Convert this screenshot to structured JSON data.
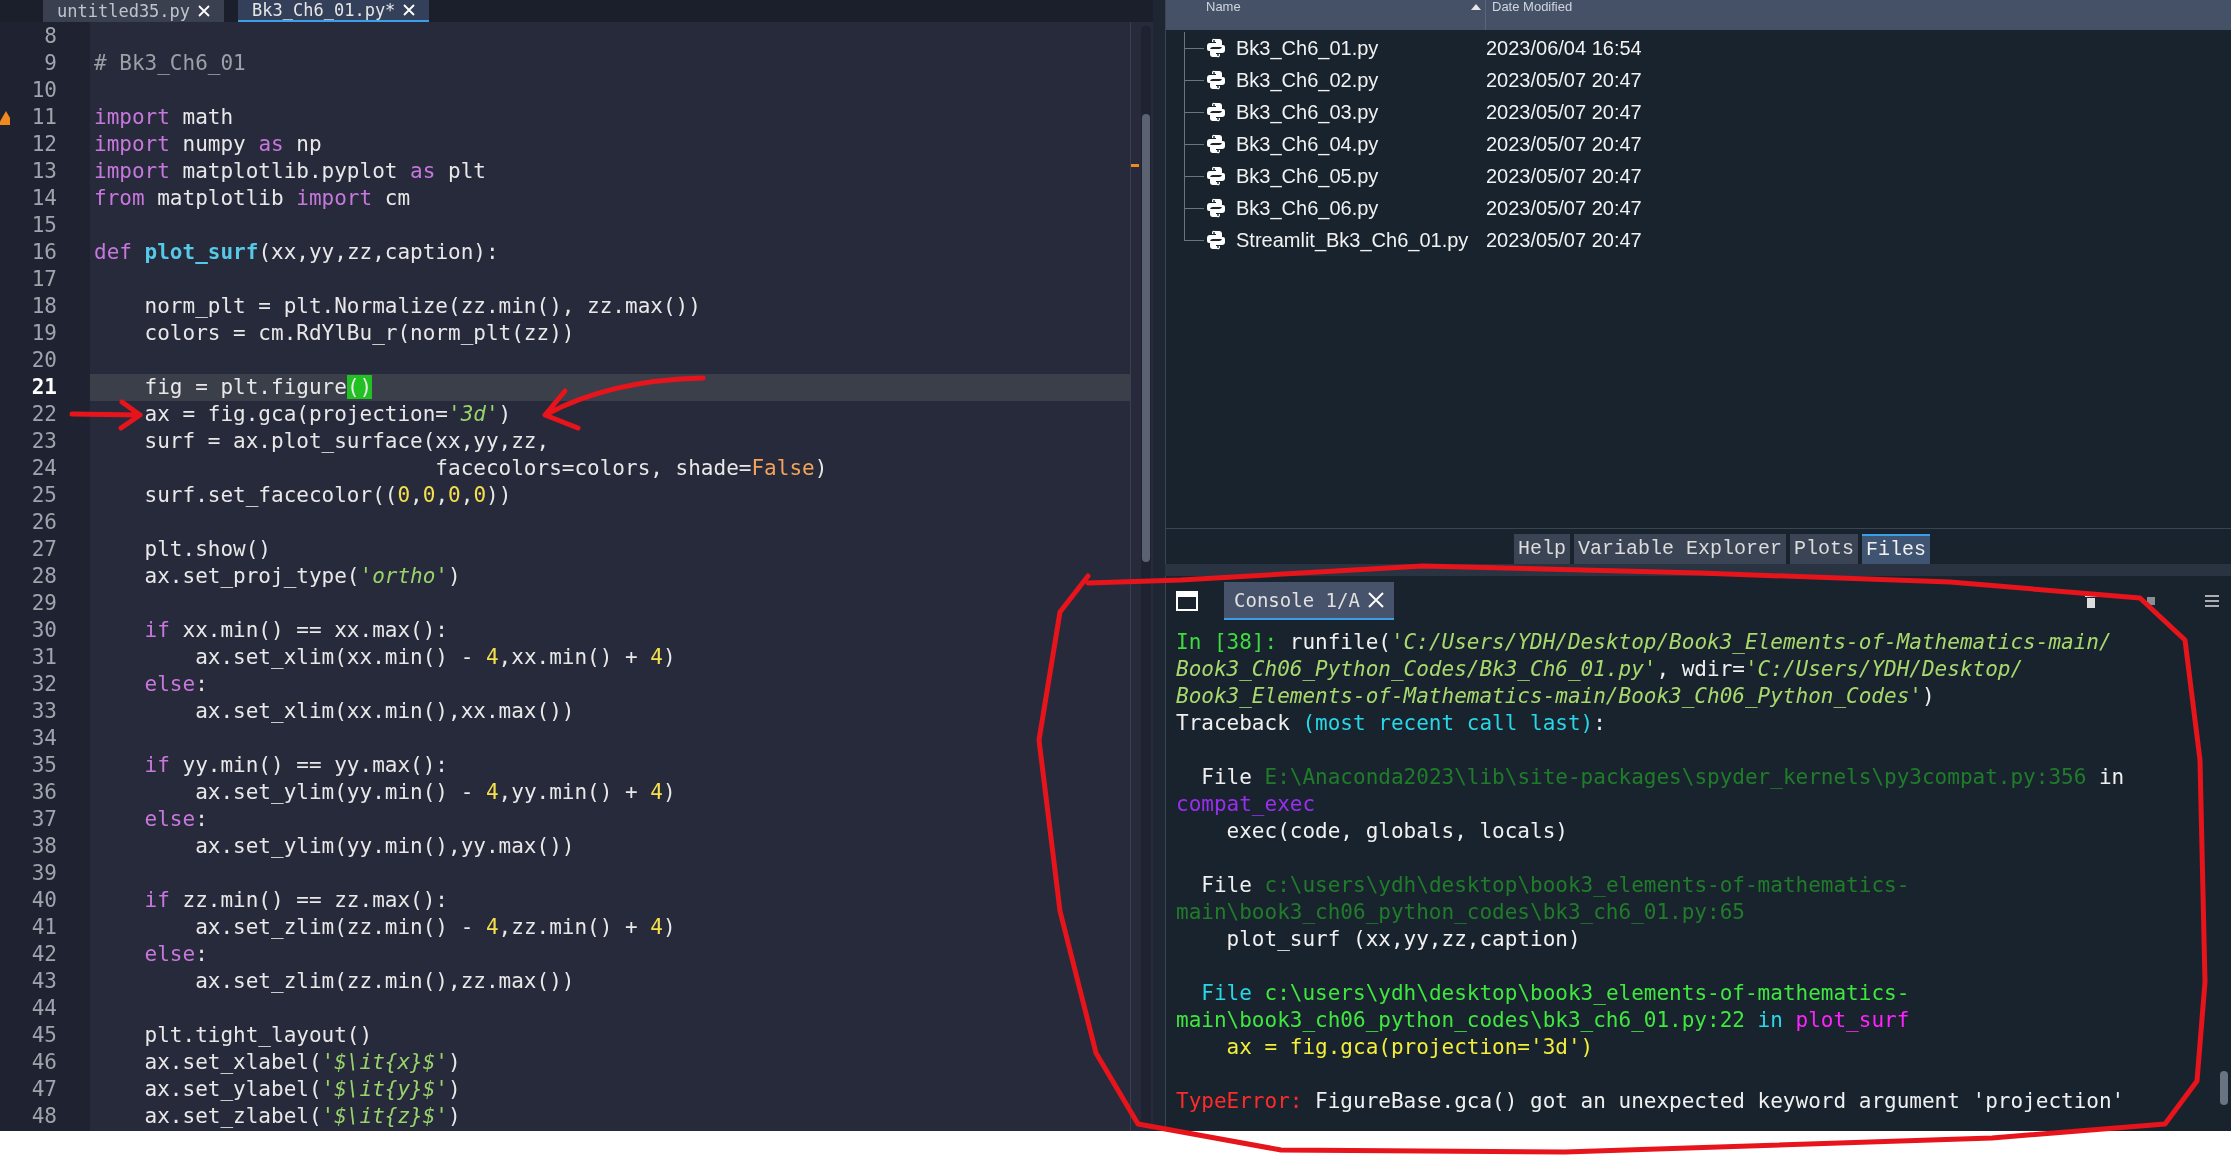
{
  "editor": {
    "tabs": [
      {
        "label": "untitled35.py",
        "selected": false
      },
      {
        "label": "Bk3_Ch6_01.py*",
        "selected": true
      }
    ],
    "lines": [
      {
        "number": "8",
        "current": false,
        "warning": false
      },
      {
        "number": "9",
        "current": false,
        "warning": false,
        "segments": [
          {
            "kind": "comment",
            "text": "# Bk3_Ch6_01"
          }
        ]
      },
      {
        "number": "10",
        "current": false,
        "warning": false
      },
      {
        "number": "11",
        "current": false,
        "warning": true,
        "segments": [
          {
            "kind": "keyword",
            "text": "import"
          },
          {
            "kind": "plain",
            "text": " math"
          }
        ]
      },
      {
        "number": "12",
        "current": false,
        "warning": false,
        "segments": [
          {
            "kind": "keyword",
            "text": "import"
          },
          {
            "kind": "plain",
            "text": " numpy "
          },
          {
            "kind": "keyword",
            "text": "as"
          },
          {
            "kind": "plain",
            "text": " np"
          }
        ]
      },
      {
        "number": "13",
        "current": false,
        "warning": false,
        "segments": [
          {
            "kind": "keyword",
            "text": "import"
          },
          {
            "kind": "plain",
            "text": " matplotlib.pyplot "
          },
          {
            "kind": "keyword",
            "text": "as"
          },
          {
            "kind": "plain",
            "text": " plt"
          }
        ]
      },
      {
        "number": "14",
        "current": false,
        "warning": false,
        "segments": [
          {
            "kind": "keyword",
            "text": "from"
          },
          {
            "kind": "plain",
            "text": " matplotlib "
          },
          {
            "kind": "keyword",
            "text": "import"
          },
          {
            "kind": "plain",
            "text": " cm"
          }
        ]
      },
      {
        "number": "15",
        "current": false,
        "warning": false
      },
      {
        "number": "16",
        "current": false,
        "warning": false,
        "segments": [
          {
            "kind": "keyword",
            "text": "def "
          },
          {
            "kind": "definition",
            "text": "plot_surf"
          },
          {
            "kind": "plain",
            "text": "(xx,yy,zz,caption):"
          }
        ]
      },
      {
        "number": "17",
        "current": false,
        "warning": false
      },
      {
        "number": "18",
        "current": false,
        "warning": false,
        "segments": [
          {
            "kind": "plain",
            "text": "    norm_plt = plt.Normalize(zz.min(), zz.max())"
          }
        ]
      },
      {
        "number": "19",
        "current": false,
        "warning": false,
        "segments": [
          {
            "kind": "plain",
            "text": "    colors = cm.RdYlBu_r(norm_plt(zz))"
          }
        ]
      },
      {
        "number": "20",
        "current": false,
        "warning": false
      },
      {
        "number": "21",
        "current": true,
        "warning": false,
        "segments": [
          {
            "kind": "plain",
            "text": "    fig = plt.figure"
          },
          {
            "kind": "match",
            "text": "()"
          }
        ]
      },
      {
        "number": "22",
        "current": false,
        "warning": false,
        "segments": [
          {
            "kind": "plain",
            "text": "    ax = fig.gca(projection="
          },
          {
            "kind": "string",
            "text": "'3d'"
          },
          {
            "kind": "plain",
            "text": ")"
          }
        ]
      },
      {
        "number": "23",
        "current": false,
        "warning": false,
        "segments": [
          {
            "kind": "plain",
            "text": "    surf = ax.plot_surface(xx,yy,zz,"
          }
        ]
      },
      {
        "number": "24",
        "current": false,
        "warning": false,
        "segments": [
          {
            "kind": "plain",
            "text": "                           facecolors=colors, shade="
          },
          {
            "kind": "constant",
            "text": "False"
          },
          {
            "kind": "plain",
            "text": ")"
          }
        ]
      },
      {
        "number": "25",
        "current": false,
        "warning": false,
        "segments": [
          {
            "kind": "plain",
            "text": "    surf.set_facecolor(("
          },
          {
            "kind": "number",
            "text": "0"
          },
          {
            "kind": "plain",
            "text": ","
          },
          {
            "kind": "number",
            "text": "0"
          },
          {
            "kind": "plain",
            "text": ","
          },
          {
            "kind": "number",
            "text": "0"
          },
          {
            "kind": "plain",
            "text": ","
          },
          {
            "kind": "number",
            "text": "0"
          },
          {
            "kind": "plain",
            "text": "))"
          }
        ]
      },
      {
        "number": "26",
        "current": false,
        "warning": false
      },
      {
        "number": "27",
        "current": false,
        "warning": false,
        "segments": [
          {
            "kind": "plain",
            "text": "    plt.show()"
          }
        ]
      },
      {
        "number": "28",
        "current": false,
        "warning": false,
        "segments": [
          {
            "kind": "plain",
            "text": "    ax.set_proj_type("
          },
          {
            "kind": "string",
            "text": "'ortho'"
          },
          {
            "kind": "plain",
            "text": ")"
          }
        ]
      },
      {
        "number": "29",
        "current": false,
        "warning": false
      },
      {
        "number": "30",
        "current": false,
        "warning": false,
        "segments": [
          {
            "kind": "keyword",
            "text": "    if"
          },
          {
            "kind": "plain",
            "text": " xx.min() == xx.max():"
          }
        ]
      },
      {
        "number": "31",
        "current": false,
        "warning": false,
        "segments": [
          {
            "kind": "plain",
            "text": "        ax.set_xlim(xx.min() - "
          },
          {
            "kind": "number",
            "text": "4"
          },
          {
            "kind": "plain",
            "text": ",xx.min() + "
          },
          {
            "kind": "number",
            "text": "4"
          },
          {
            "kind": "plain",
            "text": ")"
          }
        ]
      },
      {
        "number": "32",
        "current": false,
        "warning": false,
        "segments": [
          {
            "kind": "keyword",
            "text": "    else"
          },
          {
            "kind": "plain",
            "text": ":"
          }
        ]
      },
      {
        "number": "33",
        "current": false,
        "warning": false,
        "segments": [
          {
            "kind": "plain",
            "text": "        ax.set_xlim(xx.min(),xx.max())"
          }
        ]
      },
      {
        "number": "34",
        "current": false,
        "warning": false
      },
      {
        "number": "35",
        "current": false,
        "warning": false,
        "segments": [
          {
            "kind": "keyword",
            "text": "    if"
          },
          {
            "kind": "plain",
            "text": " yy.min() == yy.max():"
          }
        ]
      },
      {
        "number": "36",
        "current": false,
        "warning": false,
        "segments": [
          {
            "kind": "plain",
            "text": "        ax.set_ylim(yy.min() - "
          },
          {
            "kind": "number",
            "text": "4"
          },
          {
            "kind": "plain",
            "text": ",yy.min() + "
          },
          {
            "kind": "number",
            "text": "4"
          },
          {
            "kind": "plain",
            "text": ")"
          }
        ]
      },
      {
        "number": "37",
        "current": false,
        "warning": false,
        "segments": [
          {
            "kind": "keyword",
            "text": "    else"
          },
          {
            "kind": "plain",
            "text": ":"
          }
        ]
      },
      {
        "number": "38",
        "current": false,
        "warning": false,
        "segments": [
          {
            "kind": "plain",
            "text": "        ax.set_ylim(yy.min(),yy.max())"
          }
        ]
      },
      {
        "number": "39",
        "current": false,
        "warning": false
      },
      {
        "number": "40",
        "current": false,
        "warning": false,
        "segments": [
          {
            "kind": "keyword",
            "text": "    if"
          },
          {
            "kind": "plain",
            "text": " zz.min() == zz.max():"
          }
        ]
      },
      {
        "number": "41",
        "current": false,
        "warning": false,
        "segments": [
          {
            "kind": "plain",
            "text": "        ax.set_zlim(zz.min() - "
          },
          {
            "kind": "number",
            "text": "4"
          },
          {
            "kind": "plain",
            "text": ",zz.min() + "
          },
          {
            "kind": "number",
            "text": "4"
          },
          {
            "kind": "plain",
            "text": ")"
          }
        ]
      },
      {
        "number": "42",
        "current": false,
        "warning": false,
        "segments": [
          {
            "kind": "keyword",
            "text": "    else"
          },
          {
            "kind": "plain",
            "text": ":"
          }
        ]
      },
      {
        "number": "43",
        "current": false,
        "warning": false,
        "segments": [
          {
            "kind": "plain",
            "text": "        ax.set_zlim(zz.min(),zz.max())"
          }
        ]
      },
      {
        "number": "44",
        "current": false,
        "warning": false
      },
      {
        "number": "45",
        "current": false,
        "warning": false,
        "segments": [
          {
            "kind": "plain",
            "text": "    plt.tight_layout()"
          }
        ]
      },
      {
        "number": "46",
        "current": false,
        "warning": false,
        "segments": [
          {
            "kind": "plain",
            "text": "    ax.set_xlabel("
          },
          {
            "kind": "string",
            "text": "'$\\it{x}$'"
          },
          {
            "kind": "plain",
            "text": ")"
          }
        ]
      },
      {
        "number": "47",
        "current": false,
        "warning": false,
        "segments": [
          {
            "kind": "plain",
            "text": "    ax.set_ylabel("
          },
          {
            "kind": "string",
            "text": "'$\\it{y}$'"
          },
          {
            "kind": "plain",
            "text": ")"
          }
        ]
      },
      {
        "number": "48",
        "current": false,
        "warning": false,
        "segments": [
          {
            "kind": "plain",
            "text": "    ax.set_zlabel("
          },
          {
            "kind": "string",
            "text": "'$\\it{z}$'"
          },
          {
            "kind": "plain",
            "text": ")"
          }
        ]
      }
    ]
  },
  "files": {
    "columns": [
      "Name",
      "Date Modified"
    ],
    "rows": [
      {
        "name": "Bk3_Ch6_01.py",
        "modified": "2023/06/04 16:54"
      },
      {
        "name": "Bk3_Ch6_02.py",
        "modified": "2023/05/07 20:47"
      },
      {
        "name": "Bk3_Ch6_03.py",
        "modified": "2023/05/07 20:47"
      },
      {
        "name": "Bk3_Ch6_04.py",
        "modified": "2023/05/07 20:47"
      },
      {
        "name": "Bk3_Ch6_05.py",
        "modified": "2023/05/07 20:47"
      },
      {
        "name": "Bk3_Ch6_06.py",
        "modified": "2023/05/07 20:47"
      },
      {
        "name": "Streamlit_Bk3_Ch6_01.py",
        "modified": "2023/05/07 20:47"
      }
    ]
  },
  "pane_tabs": [
    {
      "label": "Help",
      "selected": false
    },
    {
      "label": "Variable Explorer",
      "selected": false
    },
    {
      "label": "Plots",
      "selected": false
    },
    {
      "label": "Files",
      "selected": true
    }
  ],
  "console": {
    "tab": "Console 1/A",
    "lines": [
      {
        "kind": "text",
        "segments": [
          {
            "kind": "prompt",
            "text": "In [38]:"
          },
          {
            "kind": "plain",
            "text": " runfile("
          },
          {
            "kind": "string",
            "text": "'C:/Users/YDH/Desktop/Book3_Elements-of-Mathematics-main/"
          }
        ]
      },
      {
        "kind": "text",
        "segments": [
          {
            "kind": "string",
            "text": "Book3_Ch06_Python_Codes/Bk3_Ch6_01.py'"
          },
          {
            "kind": "plain",
            "text": ", wdir="
          },
          {
            "kind": "string",
            "text": "'C:/Users/YDH/Desktop/"
          }
        ]
      },
      {
        "kind": "text",
        "segments": [
          {
            "kind": "string",
            "text": "Book3_Elements-of-Mathematics-main/Book3_Ch06_Python_Codes'"
          },
          {
            "kind": "plain",
            "text": ")"
          }
        ]
      },
      {
        "kind": "text",
        "segments": [
          {
            "kind": "plain",
            "text": "Traceback "
          },
          {
            "kind": "keyword",
            "text": "(most recent call last)"
          },
          {
            "kind": "plain",
            "text": ":"
          }
        ]
      },
      {
        "kind": "blank"
      },
      {
        "kind": "text",
        "segments": [
          {
            "kind": "plain",
            "text": "  File "
          },
          {
            "kind": "dim-path",
            "text": "E:\\Anaconda2023\\lib\\site-packages\\spyder_kernels\\py3compat.py:356"
          },
          {
            "kind": "plain",
            "text": " in"
          }
        ]
      },
      {
        "kind": "text",
        "segments": [
          {
            "kind": "dim-function",
            "text": "compat_exec"
          }
        ]
      },
      {
        "kind": "text",
        "segments": [
          {
            "kind": "plain",
            "text": "    exec(code, globals, locals)"
          }
        ]
      },
      {
        "kind": "blank"
      },
      {
        "kind": "text",
        "segments": [
          {
            "kind": "plain",
            "text": "  File "
          },
          {
            "kind": "dim-path",
            "text": "c:\\users\\ydh\\desktop\\book3_elements-of-mathematics-"
          }
        ]
      },
      {
        "kind": "text",
        "segments": [
          {
            "kind": "dim-path",
            "text": "main\\book3_ch06_python_codes\\bk3_ch6_01.py:65"
          }
        ]
      },
      {
        "kind": "text",
        "segments": [
          {
            "kind": "plain",
            "text": "    plot_surf (xx,yy,zz,caption)"
          }
        ]
      },
      {
        "kind": "blank"
      },
      {
        "kind": "text",
        "segments": [
          {
            "kind": "keyword",
            "text": "  File "
          },
          {
            "kind": "path",
            "text": "c:\\users\\ydh\\desktop\\book3_elements-of-mathematics-"
          }
        ]
      },
      {
        "kind": "text",
        "segments": [
          {
            "kind": "path",
            "text": "main\\book3_ch06_python_codes\\bk3_ch6_01.py:22"
          },
          {
            "kind": "keyword",
            "text": " in "
          },
          {
            "kind": "function",
            "text": "plot_surf"
          }
        ]
      },
      {
        "kind": "text",
        "segments": [
          {
            "kind": "code",
            "text": "    ax = fig.gca(projection='3d')"
          }
        ]
      },
      {
        "kind": "blank"
      },
      {
        "kind": "text",
        "segments": [
          {
            "kind": "error",
            "text": "TypeError:"
          },
          {
            "kind": "plain",
            "text": " FigureBase.gca() got an unexpected keyword argument 'projection'"
          }
        ]
      }
    ]
  }
}
